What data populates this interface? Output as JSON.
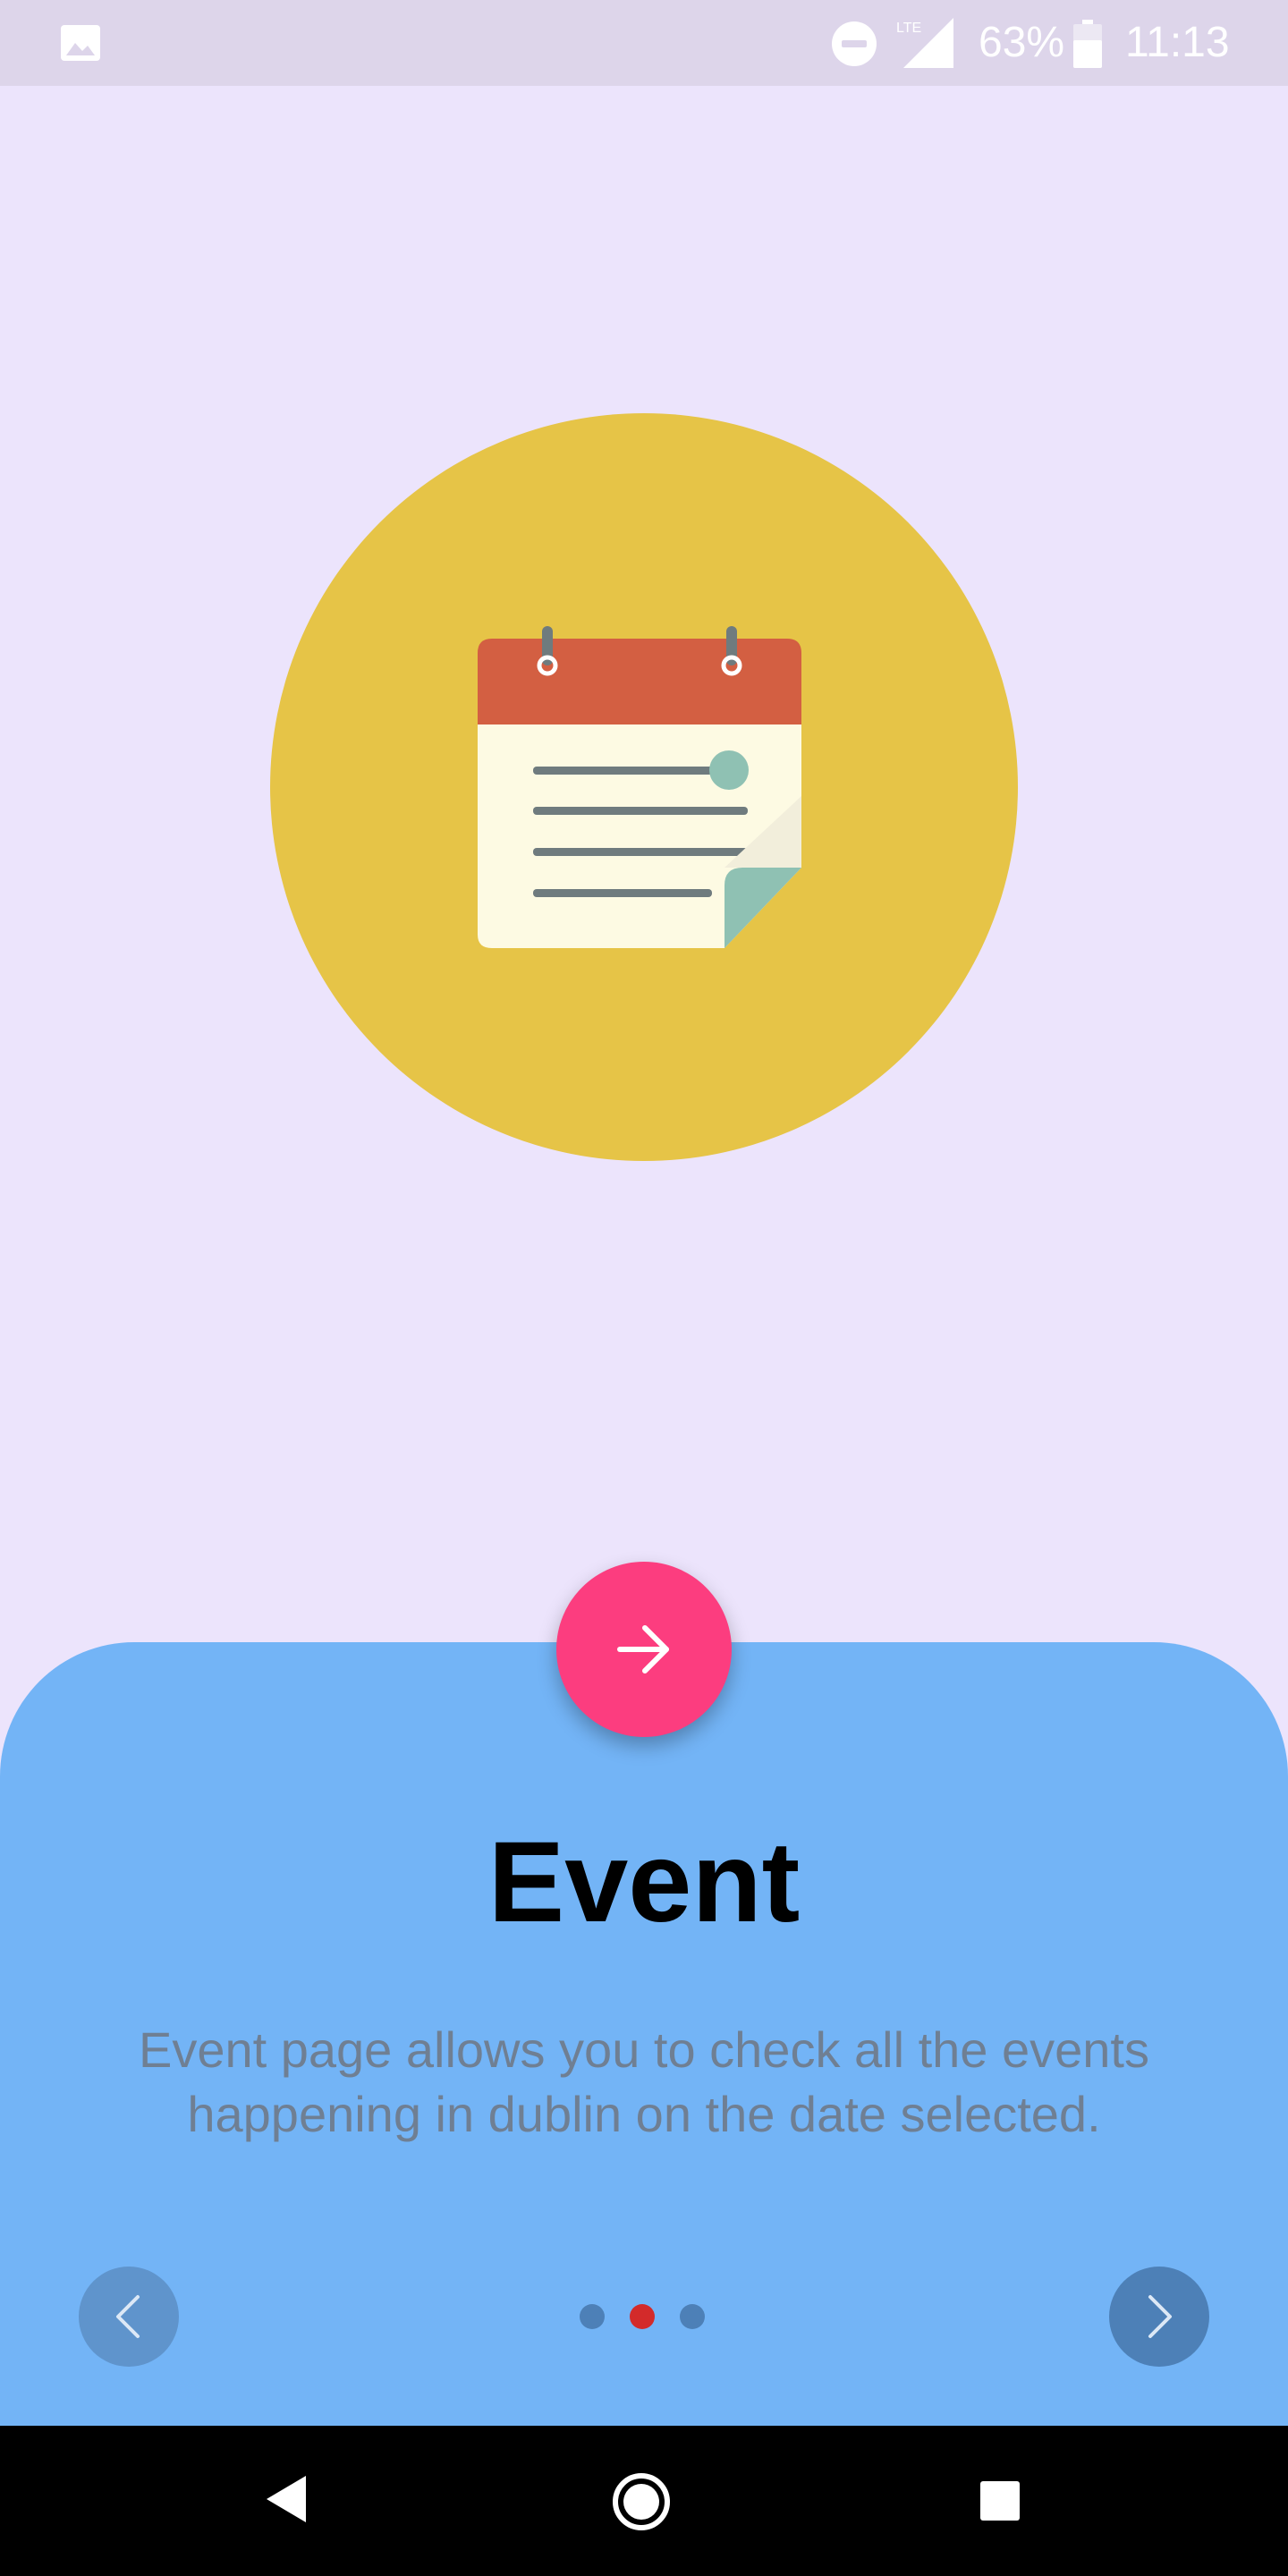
{
  "status_bar": {
    "battery": "63%",
    "time": "11:13",
    "network": "LTE",
    "icons": [
      "gallery-icon",
      "do-not-disturb-icon",
      "lte-signal-icon",
      "battery-icon"
    ]
  },
  "hero": {
    "circle_color": "#e6c447",
    "icon": "calendar-icon"
  },
  "slide": {
    "title": "Event",
    "description": "Event page allows you to check all the events happening in dublin on the date selected."
  },
  "controls": {
    "fab_icon": "arrow-right-icon",
    "fab_color": "#fc3d7f",
    "prev_icon": "chevron-left-icon",
    "next_icon": "chevron-right-icon",
    "current_page": 2,
    "total_pages": 3
  },
  "colors": {
    "background": "#ece4fc",
    "card": "#73b4f6",
    "dot_inactive": "#4d80b7",
    "dot_active": "#d32a2a"
  },
  "nav_bar": {
    "icons": [
      "back-icon",
      "home-icon",
      "recents-icon"
    ]
  }
}
